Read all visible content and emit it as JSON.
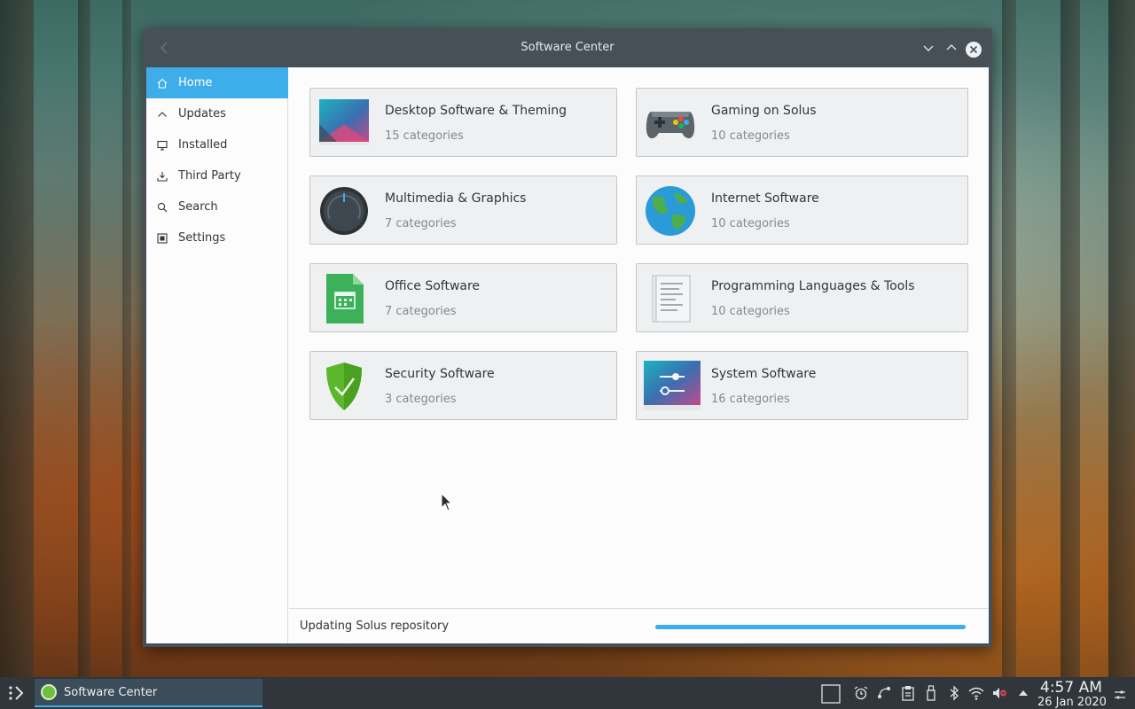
{
  "window": {
    "title": "Software Center"
  },
  "sidebar": {
    "items": [
      {
        "label": "Home",
        "icon": "home-icon",
        "active": true
      },
      {
        "label": "Updates",
        "icon": "chevron-up-icon",
        "active": false
      },
      {
        "label": "Installed",
        "icon": "monitor-icon",
        "active": false
      },
      {
        "label": "Third Party",
        "icon": "download-icon",
        "active": false
      },
      {
        "label": "Search",
        "icon": "search-icon",
        "active": false
      },
      {
        "label": "Settings",
        "icon": "settings-icon",
        "active": false
      }
    ]
  },
  "categories": [
    {
      "title": "Desktop Software & Theming",
      "subtitle": "15 categories",
      "icon": "desktop-theming-icon"
    },
    {
      "title": "Gaming on Solus",
      "subtitle": "10 categories",
      "icon": "gamepad-icon"
    },
    {
      "title": "Multimedia & Graphics",
      "subtitle": "7 categories",
      "icon": "multimedia-knob-icon"
    },
    {
      "title": "Internet Software",
      "subtitle": "10 categories",
      "icon": "globe-icon"
    },
    {
      "title": "Office Software",
      "subtitle": "7 categories",
      "icon": "calendar-document-icon"
    },
    {
      "title": "Programming Languages & Tools",
      "subtitle": "10 categories",
      "icon": "text-document-icon"
    },
    {
      "title": "Security Software",
      "subtitle": "3 categories",
      "icon": "shield-check-icon"
    },
    {
      "title": "System Software",
      "subtitle": "16 categories",
      "icon": "system-settings-icon"
    }
  ],
  "status": {
    "text": "Updating Solus repository",
    "progress": 1.0
  },
  "taskbar": {
    "task_label": "Software Center",
    "time": "4:57 AM",
    "date": "26 Jan 2020"
  },
  "colors": {
    "accent": "#3daee9",
    "titlebar": "#475057",
    "card_bg": "#eff0f1"
  }
}
